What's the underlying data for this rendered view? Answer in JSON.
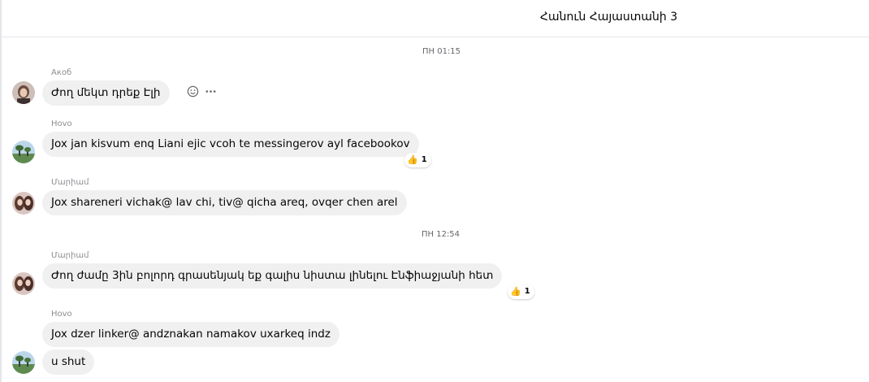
{
  "header": {
    "title": "Հանուն Հայաստանի 3"
  },
  "timestamps": [
    "ПН 01:15",
    "ПН 12:54"
  ],
  "messages": [
    {
      "sender": "Акоб",
      "text": "Ժող մեկտ դրեք Էլի"
    },
    {
      "sender": "Hovo",
      "text": "Jox jan kisvum enq Liani ejic vcoh te messingerov ayl facebookov",
      "reaction": {
        "emoji": "👍",
        "count": "1"
      }
    },
    {
      "sender": "Մարիամ",
      "text": "Jox shareneri vichak@ lav chi, tiv@ qicha areq, ovqer chen arel"
    },
    {
      "sender": "Մարիամ",
      "text": "Ժող ժամը 3ին բոլորդ գրասենյակ եք գալիս նիստա լինելու Էնֆիաջյանի հետ",
      "reaction": {
        "emoji": "👍",
        "count": "1"
      }
    },
    {
      "sender": "Hovo",
      "text": "Jox dzer linker@ andznakan namakov uxarkeq indz"
    },
    {
      "text": "u shut"
    }
  ],
  "icons": {
    "react": "smiley-icon",
    "more": "more-dots-icon",
    "reaction": "thumbs-up-icon"
  },
  "colors": {
    "bubble": "#f0f0f0",
    "meta_text": "#65676b",
    "divider": "#e4e6eb"
  }
}
